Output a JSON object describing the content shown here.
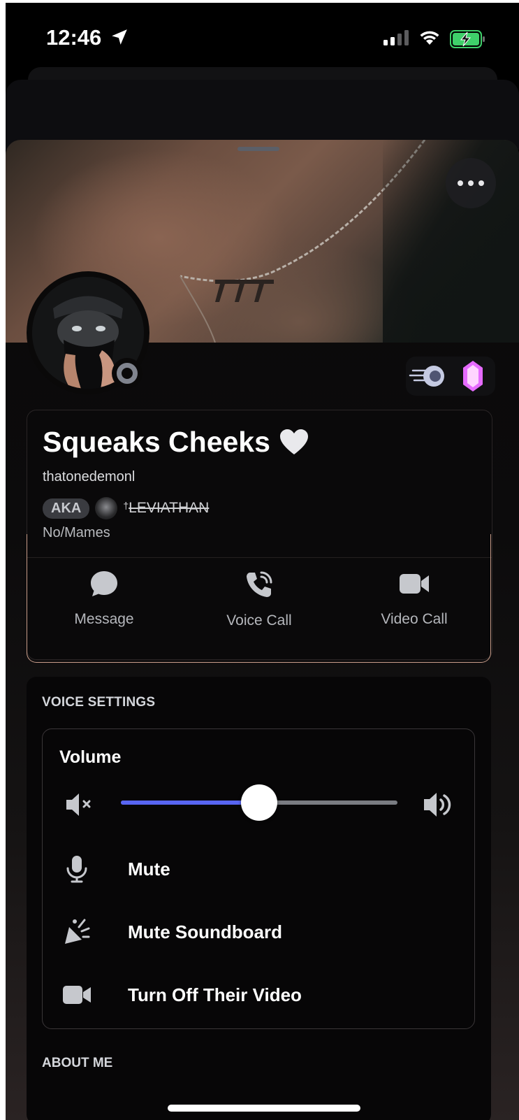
{
  "status_bar": {
    "time": "12:46",
    "icons": [
      "location-arrow-icon",
      "cellular-signal-icon",
      "wifi-icon",
      "battery-charging-icon"
    ]
  },
  "profile": {
    "display_name": "Squeaks Cheeks",
    "name_emoji": "🤍",
    "username": "thatonedemonl",
    "aka_label": "AKA",
    "aka_prefix": "†",
    "aka_name": "LEVIATHAN",
    "pronouns": "No/Mames",
    "status": "offline",
    "badges": [
      "nitro-boost-badge-icon",
      "pink-gem-badge-icon"
    ]
  },
  "actions": {
    "message": "Message",
    "voice_call": "Voice Call",
    "video_call": "Video Call"
  },
  "voice_settings": {
    "title": "VOICE SETTINGS",
    "volume_label": "Volume",
    "volume_level": 0.5,
    "accent_color": "#5865f2",
    "mute": "Mute",
    "mute_soundboard": "Mute Soundboard",
    "turn_off_video": "Turn Off Their Video"
  },
  "about": {
    "title": "ABOUT ME"
  }
}
